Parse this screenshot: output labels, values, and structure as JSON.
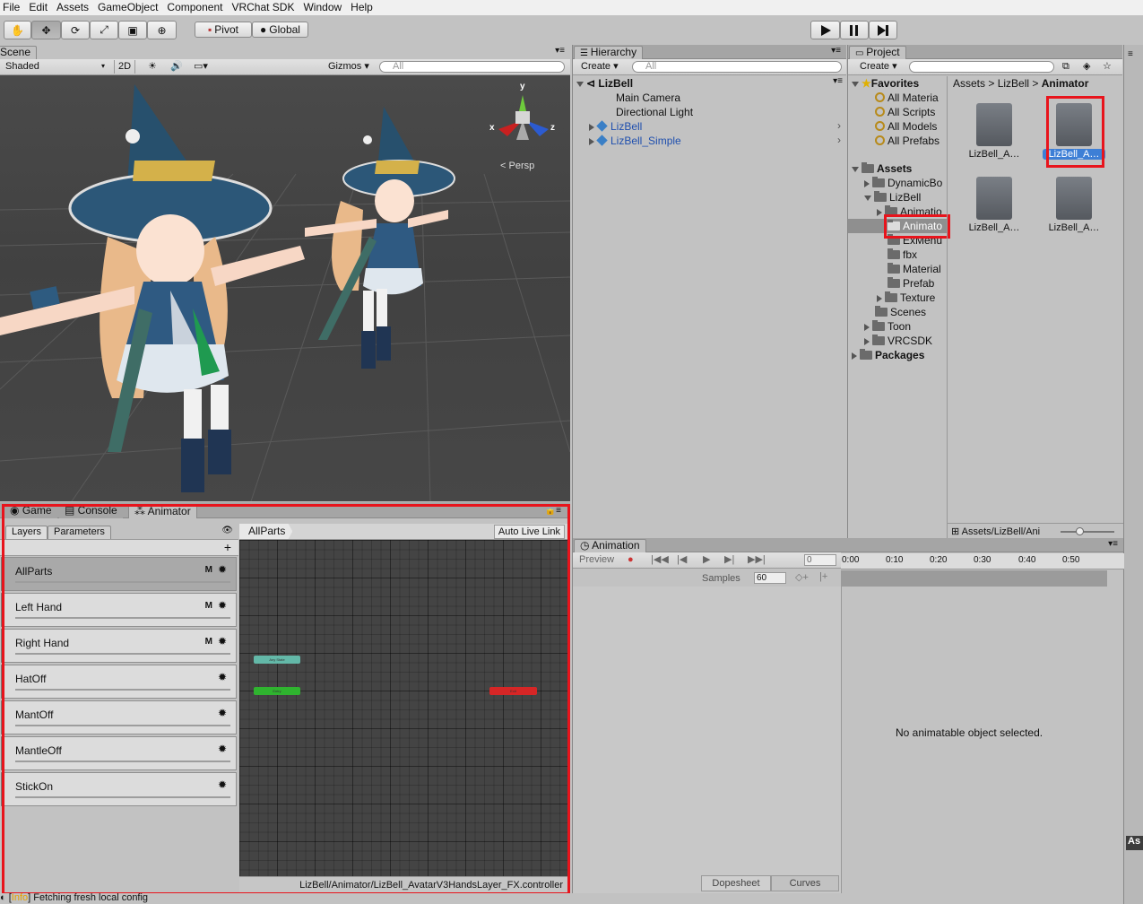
{
  "menu": [
    "File",
    "Edit",
    "Assets",
    "GameObject",
    "Component",
    "VRChat SDK",
    "Window",
    "Help"
  ],
  "toolbar": {
    "pivot": "Pivot",
    "global": "Global"
  },
  "scene": {
    "tab": "Scene",
    "shading": "Shaded",
    "mode2d": "2D",
    "gizmos": "Gizmos",
    "search_placeholder": "All",
    "persp": "Persp",
    "axis": {
      "x": "x",
      "y": "y",
      "z": "z"
    }
  },
  "hierarchy": {
    "tab": "Hierarchy",
    "create": "Create",
    "search_placeholder": "All",
    "scene_name": "LizBell",
    "items": [
      "Main Camera",
      "Directional Light",
      "LizBell",
      "LizBell_Simple"
    ]
  },
  "project": {
    "tab": "Project",
    "create": "Create",
    "favorites_label": "Favorites",
    "favorites": [
      "All Materia",
      "All Scripts",
      "All Models",
      "All Prefabs"
    ],
    "assets_label": "Assets",
    "tree": [
      "DynamicBo",
      "LizBell",
      "Animatio",
      "Animato",
      "ExMenu",
      "fbx",
      "Material",
      "Prefab",
      "Texture",
      "Scenes",
      "Toon",
      "VRCSDK"
    ],
    "packages_label": "Packages",
    "breadcrumb": [
      "Assets",
      "LizBell",
      "Animator"
    ],
    "files": [
      "LizBell_A…",
      "LizBell_A…",
      "LizBell_A…",
      "LizBell_A…"
    ],
    "footer_path": "Assets/LizBell/Ani"
  },
  "bottom_tabs": [
    "Game",
    "Console",
    "Animator"
  ],
  "animator": {
    "tab_layers": "Layers",
    "tab_params": "Parameters",
    "plus": "+",
    "breadcrumb": "AllParts",
    "auto_live": "Auto Live Link",
    "layers": [
      {
        "name": "AllParts",
        "m": "M"
      },
      {
        "name": "Left Hand",
        "m": "M"
      },
      {
        "name": "Right Hand",
        "m": "M"
      },
      {
        "name": "HatOff",
        "m": ""
      },
      {
        "name": "MantOff",
        "m": ""
      },
      {
        "name": "MantleOff",
        "m": ""
      },
      {
        "name": "StickOn",
        "m": ""
      }
    ],
    "nodes": {
      "any": "Any State",
      "entry": "Entry",
      "exit": "Exit"
    },
    "path": "LizBell/Animator/LizBell_AvatarV3HandsLayer_FX.controller"
  },
  "animation": {
    "tab": "Animation",
    "preview": "Preview",
    "frame": "0",
    "samples_label": "Samples",
    "samples": "60",
    "ticks": [
      "0:00",
      "0:10",
      "0:20",
      "0:30",
      "0:40",
      "0:50"
    ],
    "empty_msg": "No animatable object selected.",
    "dopesheet": "Dopesheet",
    "curves": "Curves"
  },
  "status": {
    "tag": "Info",
    "text": "Fetching fresh local config"
  },
  "far_right": "As",
  "colors": {
    "highlight": "#e8141c",
    "selection": "#3d7fd6"
  }
}
